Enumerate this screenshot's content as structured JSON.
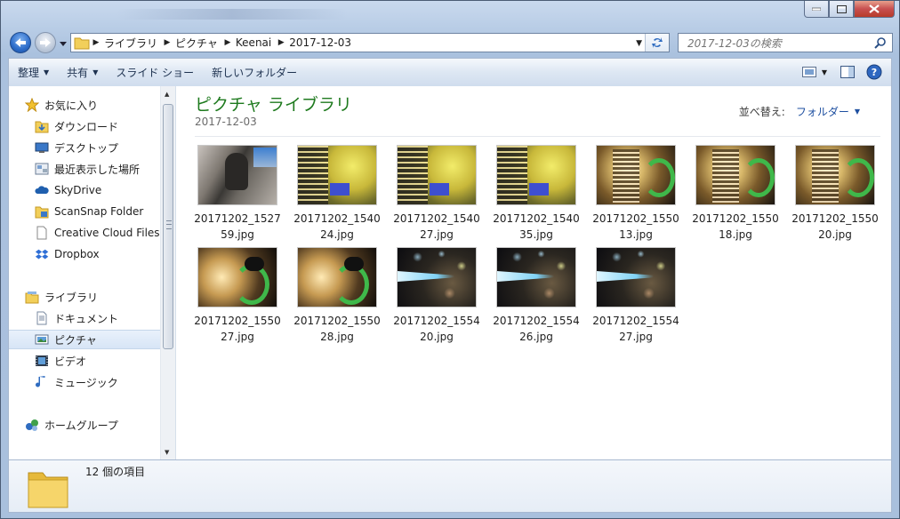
{
  "address": {
    "crumbs": [
      "ライブラリ",
      "ピクチャ",
      "Keenai",
      "2017-12-03"
    ]
  },
  "search": {
    "placeholder": "2017-12-03の検索"
  },
  "toolbar": {
    "organize": "整理",
    "share": "共有",
    "slideshow": "スライド ショー",
    "new_folder": "新しいフォルダー"
  },
  "nav": {
    "favorites": "お気に入り",
    "downloads": "ダウンロード",
    "desktop": "デスクトップ",
    "recent": "最近表示した場所",
    "skydrive": "SkyDrive",
    "scansnap": "ScanSnap Folder",
    "creative_cloud": "Creative Cloud Files",
    "dropbox": "Dropbox",
    "libraries": "ライブラリ",
    "documents": "ドキュメント",
    "pictures": "ピクチャ",
    "videos": "ビデオ",
    "music": "ミュージック",
    "homegroup": "ホームグループ"
  },
  "content": {
    "title": "ピクチャ ライブラリ",
    "subtitle": "2017-12-03",
    "arrange_label": "並べ替え:",
    "arrange_value": "フォルダー"
  },
  "files": [
    {
      "name": "20171202_152759.jpg",
      "thumb": "dog"
    },
    {
      "name": "20171202_154024.jpg",
      "thumb": "yellow"
    },
    {
      "name": "20171202_154027.jpg",
      "thumb": "yellow"
    },
    {
      "name": "20171202_154035.jpg",
      "thumb": "yellow"
    },
    {
      "name": "20171202_155013.jpg",
      "thumb": "green"
    },
    {
      "name": "20171202_155018.jpg",
      "thumb": "green"
    },
    {
      "name": "20171202_155020.jpg",
      "thumb": "green"
    },
    {
      "name": "20171202_155027.jpg",
      "thumb": "green2"
    },
    {
      "name": "20171202_155028.jpg",
      "thumb": "green2"
    },
    {
      "name": "20171202_155420.jpg",
      "thumb": "blue"
    },
    {
      "name": "20171202_155426.jpg",
      "thumb": "blue"
    },
    {
      "name": "20171202_155427.jpg",
      "thumb": "blue"
    }
  ],
  "status": {
    "count_text": "12 個の項目"
  },
  "colors": {
    "library_title": "#1e7a1e",
    "selection": "#d7e5f6",
    "accent_link": "#1e4fa0"
  }
}
